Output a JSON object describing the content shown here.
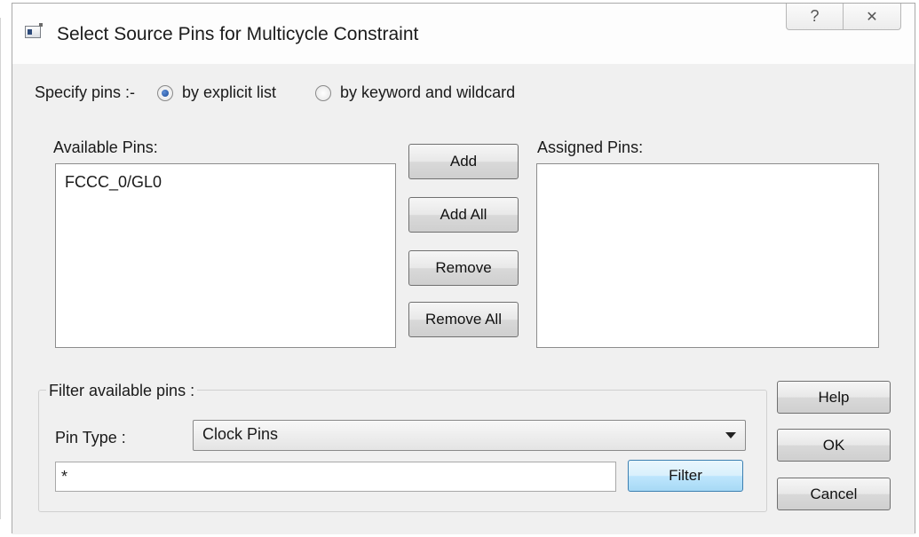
{
  "window": {
    "title": "Select Source Pins for Multicycle Constraint",
    "help_glyph": "?",
    "close_glyph": "✕"
  },
  "specify": {
    "label": "Specify pins :-",
    "options": [
      {
        "label": "by explicit list",
        "selected": true
      },
      {
        "label": "by keyword and wildcard",
        "selected": false
      }
    ]
  },
  "available": {
    "label": "Available Pins:",
    "items": [
      "FCCC_0/GL0"
    ]
  },
  "assigned": {
    "label": "Assigned Pins:",
    "items": []
  },
  "transfer_buttons": {
    "add": "Add",
    "add_all": "Add All",
    "remove": "Remove",
    "remove_all": "Remove All"
  },
  "filter": {
    "group_label": "Filter available pins :",
    "pin_type_label": "Pin Type :",
    "pin_type_value": "Clock Pins",
    "pattern_value": "*",
    "filter_button": "Filter"
  },
  "dialog_buttons": {
    "help": "Help",
    "ok": "OK",
    "cancel": "Cancel"
  }
}
